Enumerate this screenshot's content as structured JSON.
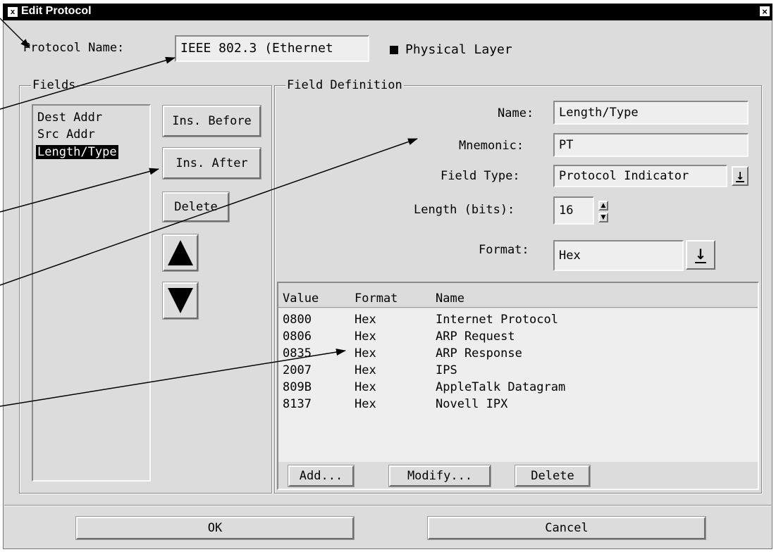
{
  "window": {
    "title": "Edit Protocol",
    "icon_glyph": "x",
    "close_glyph": "×"
  },
  "protocol": {
    "name_label": "Protocol Name:",
    "name_value": "IEEE 802.3 (Ethernet",
    "physical_layer_label": "Physical Layer",
    "physical_layer_checked": true
  },
  "fields_group": {
    "title": "Fields",
    "items": [
      {
        "label": "Dest Addr",
        "selected": false
      },
      {
        "label": "Src  Addr",
        "selected": false
      },
      {
        "label": "Length/Type",
        "selected": true
      }
    ],
    "ins_before_label": "Ins. Before",
    "ins_after_label": "Ins. After",
    "delete_label": "Delete",
    "move_up_icon": "triangle-up-icon",
    "move_down_icon": "triangle-down-icon"
  },
  "field_definition": {
    "title": "Field Definition",
    "name_label": "Name:",
    "name_value": "Length/Type",
    "mnemonic_label": "Mnemonic:",
    "mnemonic_value": "PT",
    "field_type_label": "Field Type:",
    "field_type_value": "Protocol Indicator",
    "length_label": "Length (bits):",
    "length_value": "16",
    "format_label": "Format:",
    "format_value": "Hex"
  },
  "values_table": {
    "headers": [
      "Value",
      "Format",
      "Name"
    ],
    "rows": [
      [
        "0800",
        "Hex",
        "Internet Protocol"
      ],
      [
        "0806",
        "Hex",
        "ARP Request"
      ],
      [
        "0835",
        "Hex",
        "ARP Response"
      ],
      [
        "2007",
        "Hex",
        "IPS"
      ],
      [
        "809B",
        "Hex",
        "AppleTalk Datagram"
      ],
      [
        "8137",
        "Hex",
        "Novell IPX"
      ]
    ],
    "add_label": "Add...",
    "modify_label": "Modify...",
    "delete_label": "Delete"
  },
  "footer": {
    "ok_label": "OK",
    "cancel_label": "Cancel"
  },
  "colors": {
    "titlebar": "#000000",
    "body": "#dcdcdc",
    "field": "#eeeeee",
    "selection": "#000000"
  }
}
